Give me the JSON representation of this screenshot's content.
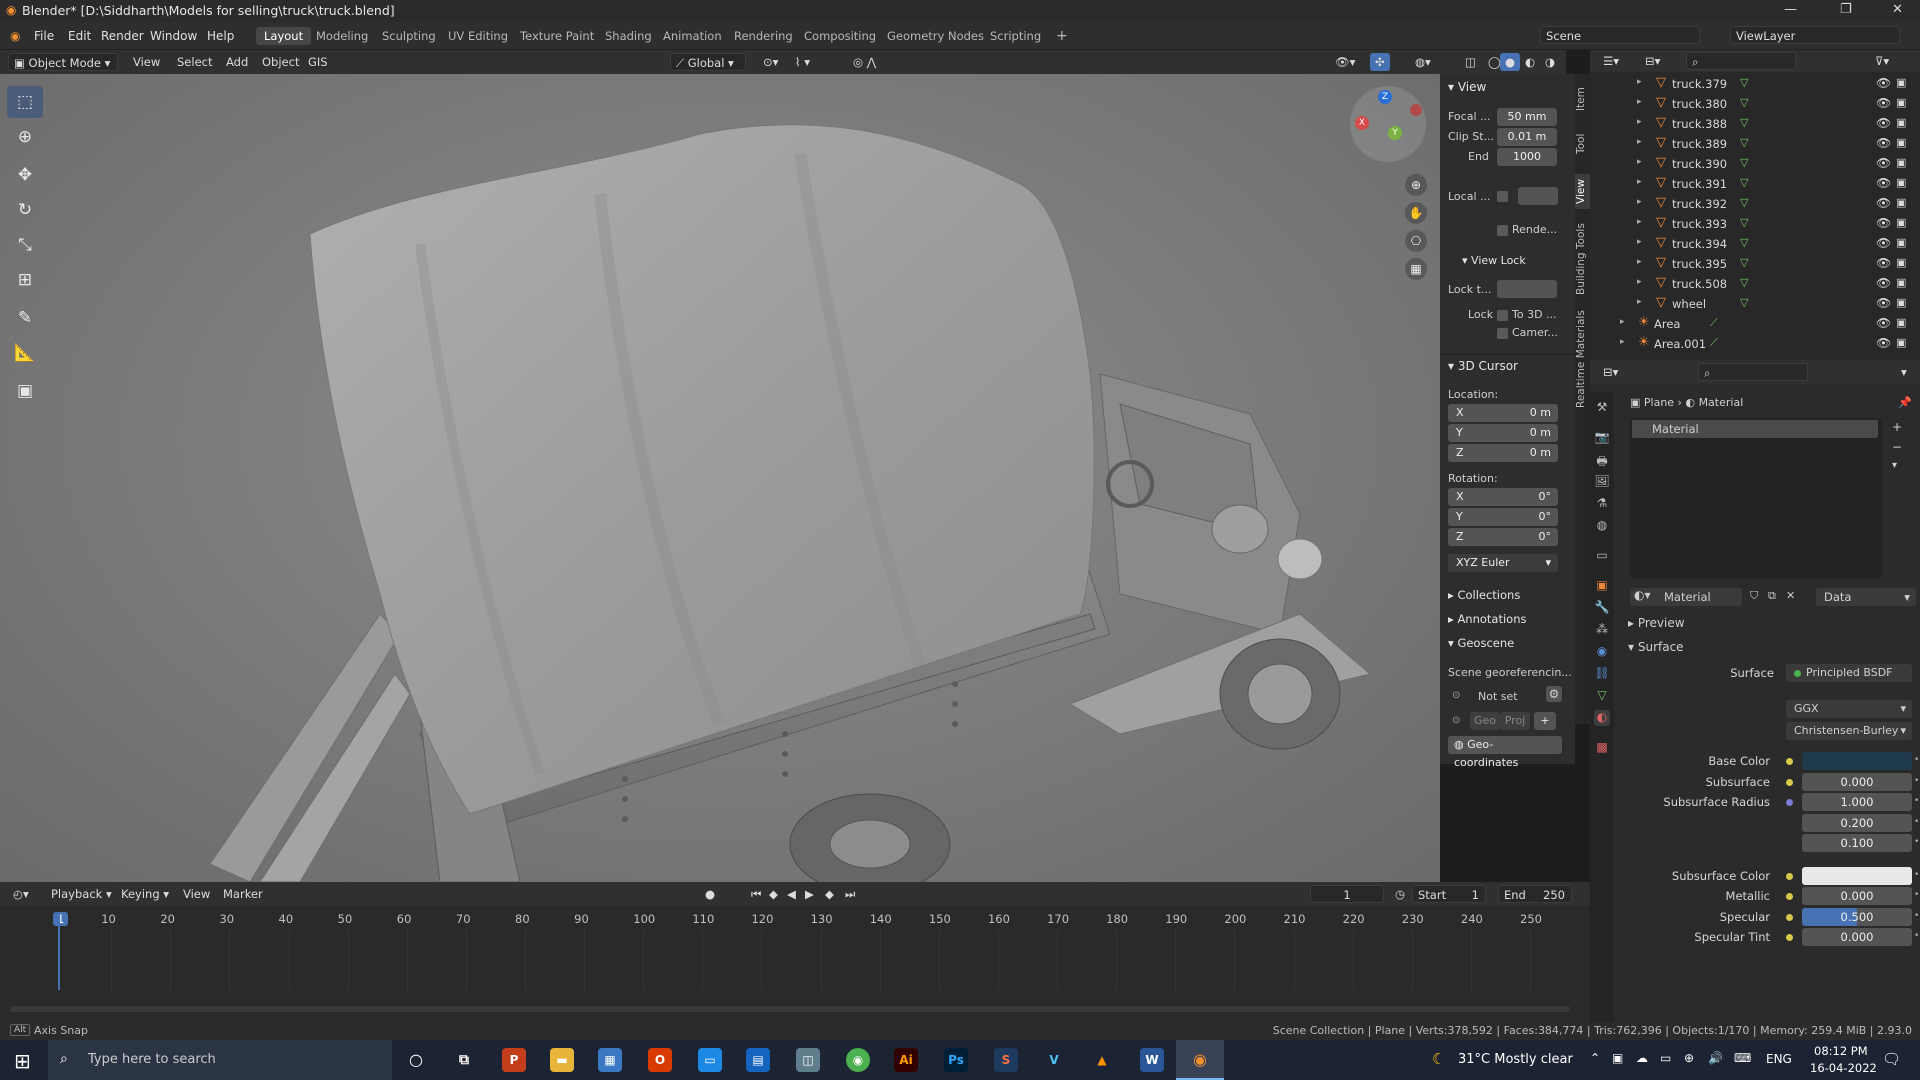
{
  "title": "Blender* [D:\\Siddharth\\Models for selling\\truck\\truck.blend]",
  "menu": [
    "File",
    "Edit",
    "Render",
    "Window",
    "Help"
  ],
  "workspaces": [
    "Layout",
    "Modeling",
    "Sculpting",
    "UV Editing",
    "Texture Paint",
    "Shading",
    "Animation",
    "Rendering",
    "Compositing",
    "Geometry Nodes",
    "Scripting"
  ],
  "active_workspace": "Layout",
  "scene": "Scene",
  "view_layer": "ViewLayer",
  "header3d": {
    "mode": "Object Mode",
    "view": "View",
    "select": "Select",
    "add": "Add",
    "object": "Object",
    "gis": "GIS",
    "orientation": "Global"
  },
  "npanel": {
    "view_title": "View",
    "focal_label": "Focal ...",
    "focal_value": "50 mm",
    "clip_start_label": "Clip St...",
    "clip_start_value": "0.01 m",
    "end_label": "End",
    "end_value": "1000",
    "local_label": "Local ...",
    "render_label": "Rende...",
    "view_lock_title": "View Lock",
    "lock_to_label": "Lock t...",
    "lock_label": "Lock",
    "to3d_label": "To 3D ...",
    "camera_label": "Camer...",
    "cursor_title": "3D Cursor",
    "location_label": "Location:",
    "loc": [
      {
        "axis": "X",
        "value": "0 m"
      },
      {
        "axis": "Y",
        "value": "0 m"
      },
      {
        "axis": "Z",
        "value": "0 m"
      }
    ],
    "rotation_label": "Rotation:",
    "rot": [
      {
        "axis": "X",
        "value": "0°"
      },
      {
        "axis": "Y",
        "value": "0°"
      },
      {
        "axis": "Z",
        "value": "0°"
      }
    ],
    "rot_mode": "XYZ Euler",
    "collections": "Collections",
    "annotations": "Annotations",
    "geoscene": "Geoscene",
    "georef": "Scene georeferencin...",
    "not_set": "Not set",
    "geo": "Geo",
    "proj": "Proj",
    "geo_coords": "Geo-coordinates"
  },
  "side_tabs": [
    "Item",
    "Tool",
    "View",
    "Building Tools",
    "Realtime Materials"
  ],
  "outliner_items": [
    {
      "name": "truck.379",
      "kind": "mesh"
    },
    {
      "name": "truck.380",
      "kind": "mesh"
    },
    {
      "name": "truck.388",
      "kind": "mesh"
    },
    {
      "name": "truck.389",
      "kind": "mesh"
    },
    {
      "name": "truck.390",
      "kind": "mesh"
    },
    {
      "name": "truck.391",
      "kind": "mesh"
    },
    {
      "name": "truck.392",
      "kind": "mesh"
    },
    {
      "name": "truck.393",
      "kind": "mesh"
    },
    {
      "name": "truck.394",
      "kind": "mesh"
    },
    {
      "name": "truck.395",
      "kind": "mesh"
    },
    {
      "name": "truck.508",
      "kind": "mesh"
    },
    {
      "name": "wheel",
      "kind": "mesh"
    },
    {
      "name": "Area",
      "kind": "light"
    },
    {
      "name": "Area.001",
      "kind": "light"
    }
  ],
  "properties": {
    "object": "Plane",
    "material_tab": "Material",
    "slot": "Material",
    "mat_name": "Material",
    "link": "Data",
    "preview": "Preview",
    "surface_title": "Surface",
    "surface_label": "Surface",
    "surface_value": "Principled BSDF",
    "distribution": "GGX",
    "sss_method": "Christensen-Burley",
    "rows": [
      {
        "label": "Base Color",
        "value": ""
      },
      {
        "label": "Subsurface",
        "value": "0.000"
      },
      {
        "label": "Subsurface Radius",
        "value": "1.000"
      },
      {
        "label": "",
        "value": "0.200"
      },
      {
        "label": "",
        "value": "0.100"
      },
      {
        "label": "Subsurface Color",
        "value": ""
      },
      {
        "label": "Metallic",
        "value": "0.000"
      },
      {
        "label": "Specular",
        "value": "0.500"
      },
      {
        "label": "Specular Tint",
        "value": "0.000"
      }
    ],
    "specular_fill": 0.5,
    "base_color": "#1f3a4a",
    "subsurface_color": "#e8e8e8"
  },
  "timeline": {
    "menus": [
      "Playback",
      "Keying",
      "View",
      "Marker"
    ],
    "current": "1",
    "start_label": "Start",
    "start": "1",
    "end_label": "End",
    "end": "250",
    "ticks": [
      "1",
      "10",
      "20",
      "30",
      "40",
      "50",
      "60",
      "70",
      "80",
      "90",
      "100",
      "110",
      "120",
      "130",
      "140",
      "150",
      "160",
      "170",
      "180",
      "190",
      "200",
      "210",
      "220",
      "230",
      "240",
      "250"
    ]
  },
  "status": {
    "left": "Axis Snap",
    "right": "Scene Collection | Plane | Verts:378,592 | Faces:384,774 | Tris:762,396 | Objects:1/170 | Memory: 259.4 MiB | 2.93.0"
  },
  "taskbar": {
    "search": "Type here to search",
    "weather": "31°C  Mostly clear",
    "lang": "ENG",
    "time": "08:12 PM",
    "date": "16-04-2022"
  }
}
